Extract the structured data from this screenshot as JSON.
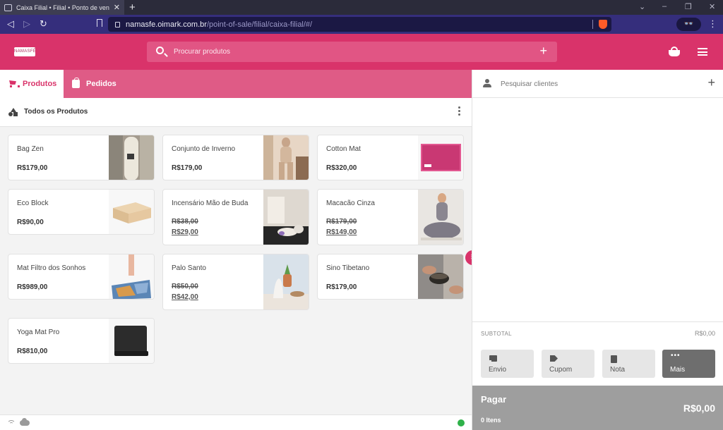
{
  "browser": {
    "tab_title": "Caixa Filial • Filial • Ponto de venda",
    "tab_close": "✕",
    "new_tab": "+",
    "url_host": "namasfe.oimark.com.br",
    "url_path": "/point-of-sale/filial/caixa-filial/#/",
    "win_min": "⌄",
    "win_max": "–",
    "win_restore": "❐",
    "win_close": "✕",
    "ext_icon": "👓",
    "menu": "⋮"
  },
  "header": {
    "logo_text": "NAMASFÉ",
    "search_placeholder": "Procurar produtos",
    "search_add": "+"
  },
  "tabs": {
    "products": "Produtos",
    "orders": "Pedidos"
  },
  "category": {
    "title": "Todos os Produtos"
  },
  "products": [
    {
      "name": "Bag Zen",
      "price": "R$179,00"
    },
    {
      "name": "Conjunto de Inverno",
      "price": "R$179,00"
    },
    {
      "name": "Cotton Mat",
      "price": "R$320,00"
    },
    {
      "name": "Eco Block",
      "price": "R$90,00"
    },
    {
      "name": "Incensário Mão de Buda",
      "old_price": "R$38,00",
      "price": "R$29,00"
    },
    {
      "name": "Macacão Cinza",
      "old_price": "R$179,00",
      "price": "R$149,00"
    },
    {
      "name": "Mat Filtro dos Sonhos",
      "price": "R$989,00"
    },
    {
      "name": "Palo Santo",
      "old_price": "R$50,00",
      "price": "R$42,00"
    },
    {
      "name": "Sino Tibetano",
      "price": "R$179,00"
    },
    {
      "name": "Yoga Mat Pro",
      "price": "R$810,00"
    }
  ],
  "cart": {
    "client_placeholder": "Pesquisar clientes",
    "client_add": "+",
    "subtotal_label": "SUBTOTAL",
    "subtotal_value": "R$0,00",
    "actions": {
      "shipping": "Envio",
      "coupon": "Cupom",
      "note": "Nota",
      "more": "Mais"
    },
    "pay_label": "Pagar",
    "total": "R$0,00",
    "items_count": "0 Itens"
  },
  "colors": {
    "brand": "#d9336a",
    "online": "#2fb14a"
  }
}
